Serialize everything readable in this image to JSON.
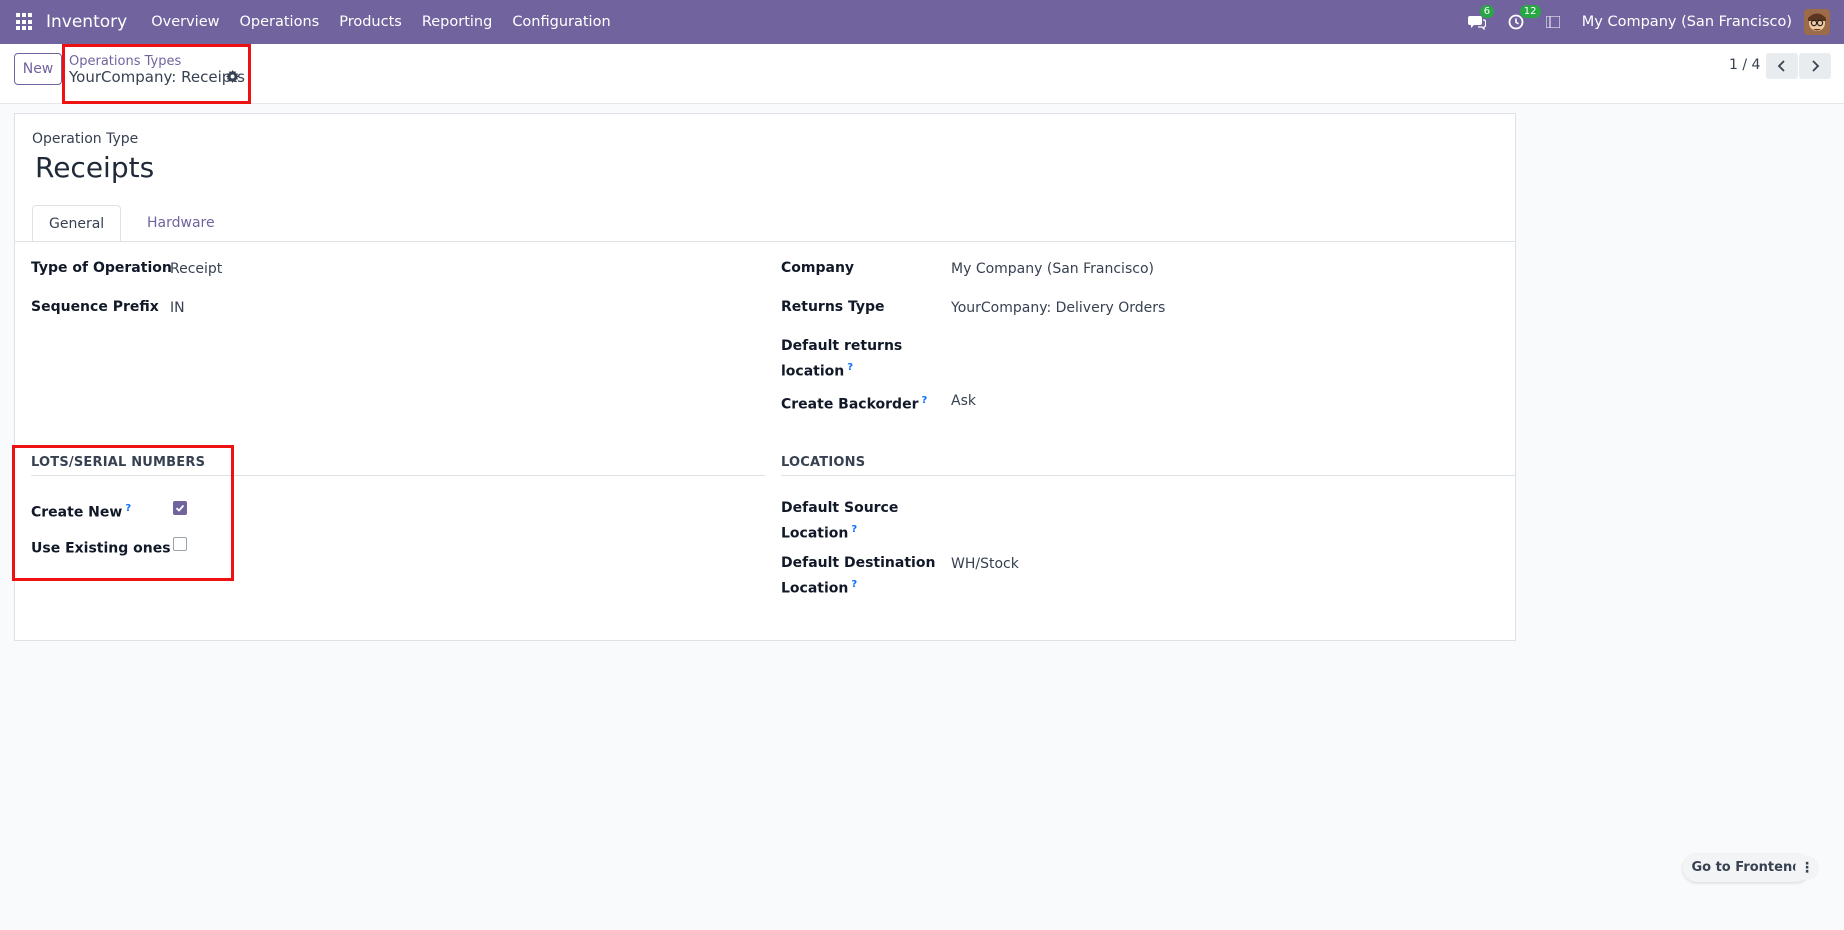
{
  "navbar": {
    "app_name": "Inventory",
    "menu": [
      "Overview",
      "Operations",
      "Products",
      "Reporting",
      "Configuration"
    ],
    "messages_count": "6",
    "activities_count": "12",
    "company": "My Company (San Francisco)"
  },
  "control_panel": {
    "new_label": "New",
    "breadcrumb_parent": "Operations Types",
    "breadcrumb_current": "YourCompany: Receipts",
    "pager": "1 / 4"
  },
  "form": {
    "operation_type_label": "Operation Type",
    "name": "Receipts",
    "tabs": [
      "General",
      "Hardware"
    ],
    "left_fields": [
      {
        "label": "Type of Operation",
        "value": "Receipt"
      },
      {
        "label": "Sequence Prefix",
        "value": "IN"
      }
    ],
    "right_fields": {
      "company_label": "Company",
      "company_value": "My Company (San Francisco)",
      "returns_type_label": "Returns Type",
      "returns_type_value": "YourCompany: Delivery Orders",
      "default_returns_label_1": "Default returns",
      "default_returns_label_2": "location",
      "create_backorder_label": "Create Backorder",
      "create_backorder_value": "Ask"
    },
    "lots_section": {
      "title": "LOTS/SERIAL NUMBERS",
      "create_new_label": "Create New",
      "create_new_checked": true,
      "use_existing_label": "Use Existing ones",
      "use_existing_checked": false
    },
    "locations_section": {
      "title": "LOCATIONS",
      "default_source_label_1": "Default Source",
      "default_source_label_2": "Location",
      "default_dest_label_1": "Default Destination",
      "default_dest_label_2": "Location",
      "default_dest_value": "WH/Stock"
    },
    "help_marker": "?"
  },
  "footer": {
    "go_to_frontend": "Go to Frontend",
    "more_icon_glyph": "⋮"
  },
  "colors": {
    "brand": "#71639e",
    "highlight": "#ee1111",
    "badge": "#28a745"
  }
}
